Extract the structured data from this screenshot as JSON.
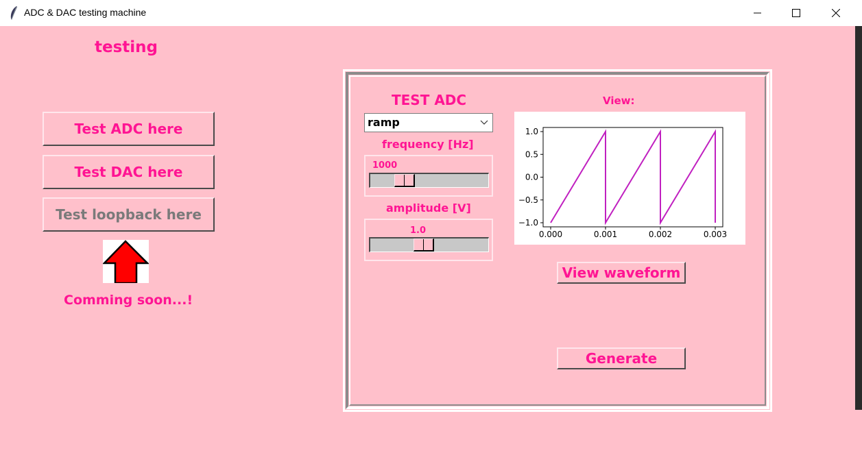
{
  "window": {
    "title": "ADC & DAC testing machine"
  },
  "left": {
    "heading": "testing",
    "buttons": [
      {
        "label": "Test ADC here"
      },
      {
        "label": "Test DAC here"
      },
      {
        "label": "Test loopback here"
      }
    ],
    "arrow_icon": "red-up-arrow-icon",
    "coming_soon": "Comming soon...!"
  },
  "panel": {
    "title": "TEST ADC",
    "waveform_select": "ramp",
    "frequency": {
      "label": "frequency [Hz]",
      "value": "1000",
      "fraction": 0.25
    },
    "amplitude": {
      "label": "amplitude [V]",
      "value": "1.0",
      "fraction": 0.45
    },
    "view_label": "View:",
    "view_button": "View waveform",
    "generate_button": "Generate"
  },
  "colors": {
    "background": "#ffc0cb",
    "accent": "#ff1493",
    "plot_line": "#c020c0",
    "arrow": "#ff0000"
  },
  "chart_data": {
    "type": "line",
    "title": "",
    "xlabel": "",
    "ylabel": "",
    "xlim": [
      0.0,
      0.003
    ],
    "ylim": [
      -1.0,
      1.0
    ],
    "x_ticks": [
      "0.000",
      "0.001",
      "0.002",
      "0.003"
    ],
    "y_ticks": [
      "1.0",
      "0.5",
      "0.0",
      "−0.5",
      "−1.0"
    ],
    "series": [
      {
        "x": [
          0.0,
          0.001,
          0.001,
          0.002,
          0.002,
          0.003,
          0.003
        ],
        "y": [
          -1.0,
          1.0,
          -1.0,
          1.0,
          -1.0,
          1.0,
          -1.0
        ]
      }
    ],
    "grid": false
  }
}
